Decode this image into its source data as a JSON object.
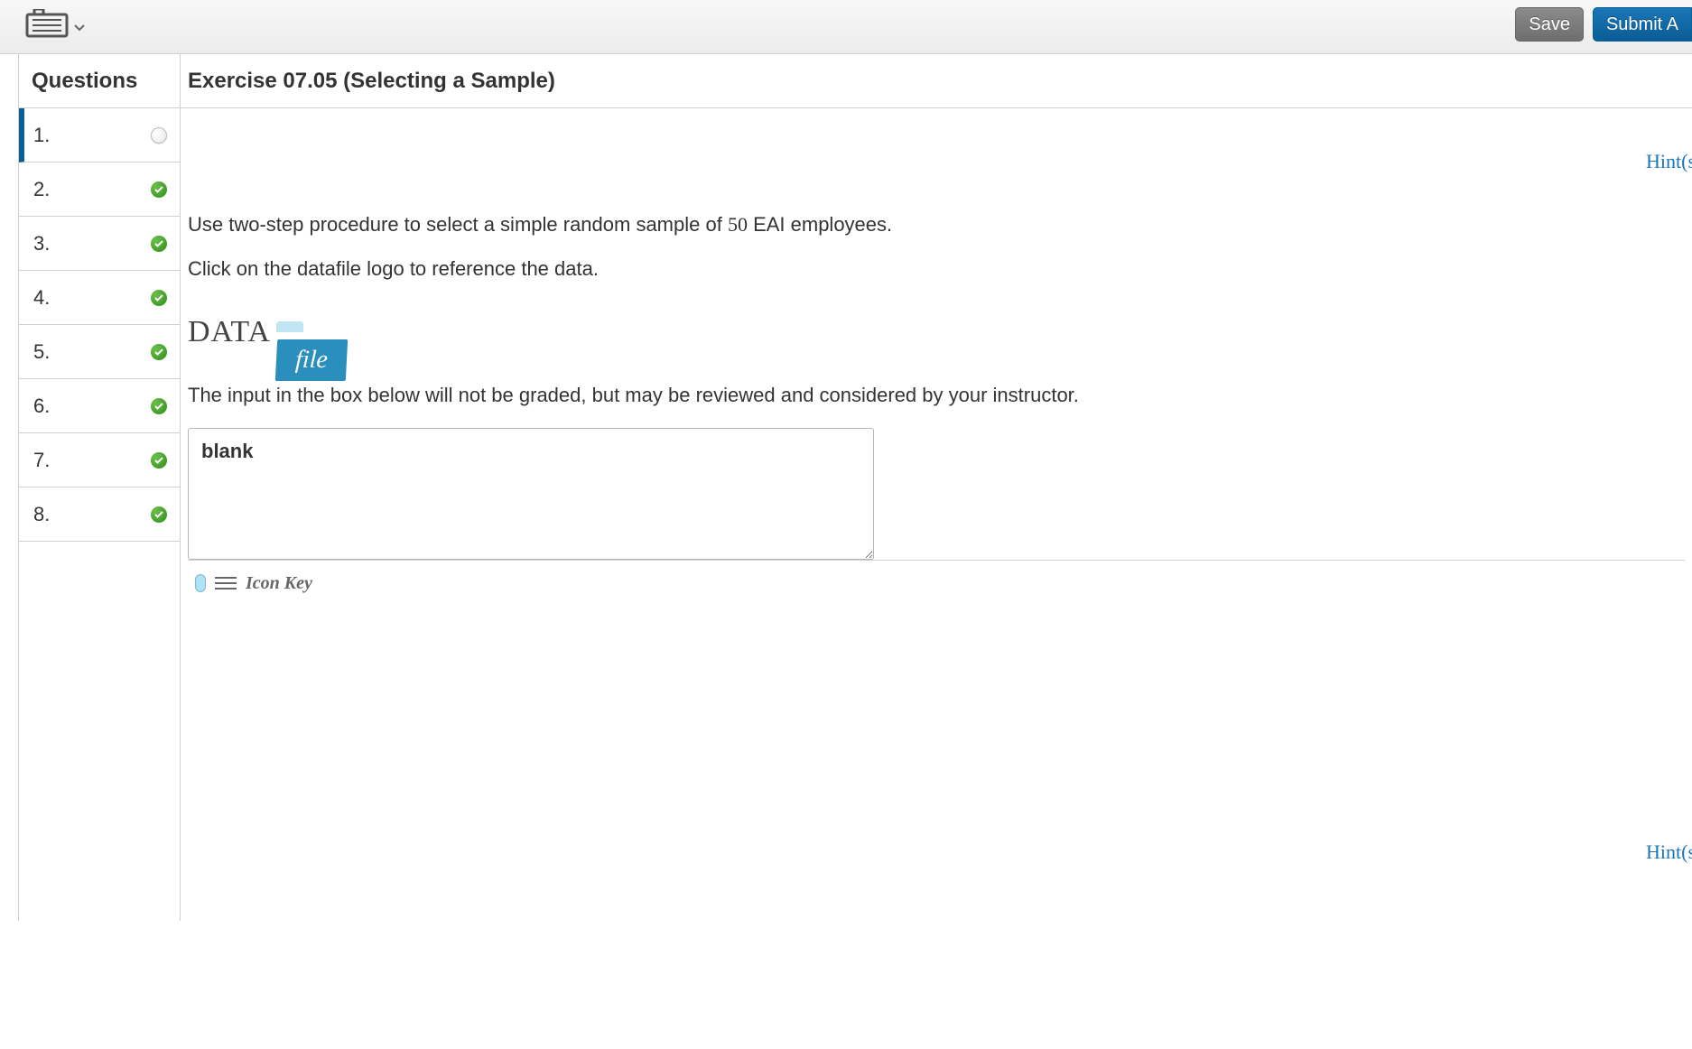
{
  "toolbar": {
    "save_label": "Save",
    "submit_label": "Submit A"
  },
  "sidebar": {
    "header": "Questions",
    "items": [
      {
        "num": "1.",
        "status": "empty",
        "active": true
      },
      {
        "num": "2.",
        "status": "checked",
        "active": false
      },
      {
        "num": "3.",
        "status": "checked",
        "active": false
      },
      {
        "num": "4.",
        "status": "checked",
        "active": false
      },
      {
        "num": "5.",
        "status": "checked",
        "active": false
      },
      {
        "num": "6.",
        "status": "checked",
        "active": false
      },
      {
        "num": "7.",
        "status": "checked",
        "active": false
      },
      {
        "num": "8.",
        "status": "checked",
        "active": false
      }
    ]
  },
  "main": {
    "title": "Exercise 07.05 (Selecting a Sample)",
    "hints_label": "Hint(s",
    "instruction_line1_a": "Use two-step procedure to select a simple random sample of ",
    "instruction_line1_num": "50",
    "instruction_line1_b": " EAI employees.",
    "instruction_line2": "Click on the datafile logo to reference the data.",
    "datafile_data_text": "DATA",
    "datafile_file_text": "file",
    "note": "The input in the box below will not be graded, but may be reviewed and considered by your instructor.",
    "answer_value": "blank",
    "iconkey_text": "Icon Key"
  }
}
